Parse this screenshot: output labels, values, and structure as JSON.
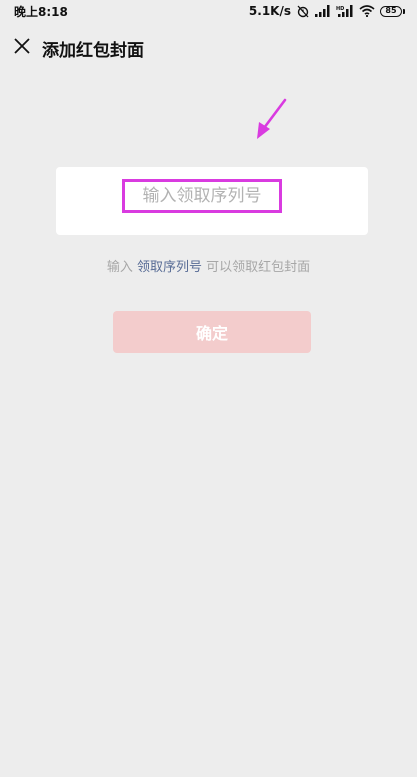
{
  "status_bar": {
    "time": "晚上8:18",
    "network_speed": "5.1K/s",
    "battery_level": "85",
    "icons": [
      "alarm-off-icon",
      "cellular-signal-icon",
      "hd-cellular-signal-icon",
      "wifi-icon",
      "battery-icon"
    ]
  },
  "nav": {
    "close_icon": "close-icon",
    "title": "添加红包封面"
  },
  "form": {
    "serial_input_placeholder": "输入领取序列号",
    "serial_input_value": "",
    "hint_prefix": "输入 ",
    "hint_link": "领取序列号",
    "hint_suffix": " 可以领取红包封面",
    "confirm_label": "确定"
  },
  "colors": {
    "background": "#ededed",
    "card": "#ffffff",
    "link": "#576b95",
    "confirm_button_disabled": "#f3cccc",
    "annotation": "#d93be0"
  }
}
